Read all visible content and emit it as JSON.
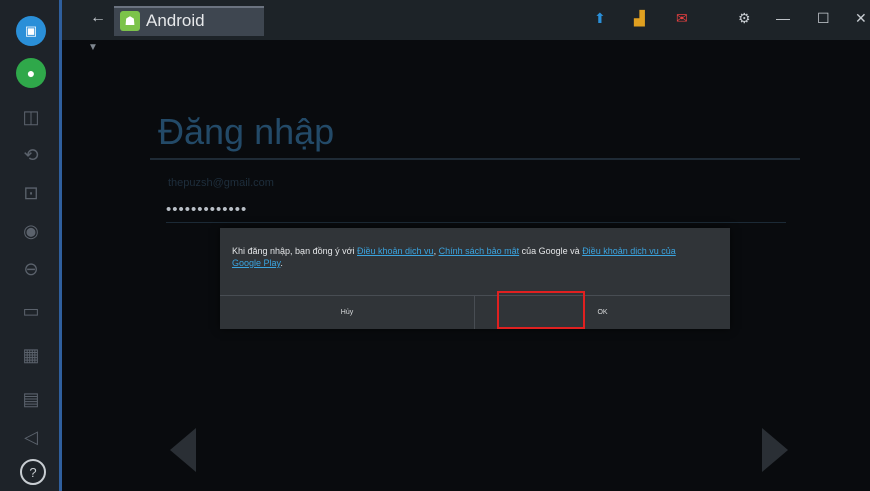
{
  "window": {
    "tab_title": "Android"
  },
  "sidebar": {
    "items": [
      {
        "icon": "camera-icon"
      },
      {
        "icon": "chat-icon"
      },
      {
        "icon": "multi-window-icon"
      },
      {
        "icon": "rotate-icon"
      },
      {
        "icon": "screenshot-icon"
      },
      {
        "icon": "location-icon"
      },
      {
        "icon": "shake-icon"
      },
      {
        "icon": "folder-icon"
      },
      {
        "icon": "copy-icon"
      },
      {
        "icon": "paste-icon"
      },
      {
        "icon": "volume-icon"
      },
      {
        "icon": "help-icon",
        "label": "?"
      }
    ]
  },
  "login": {
    "heading": "Đăng nhập",
    "email": "thepuzsh@gmail.com",
    "password_mask": "•••••••••••••"
  },
  "dialog": {
    "msg_1": "Khi đăng nhập, bạn đồng ý với ",
    "link_1": "Điều khoản dịch vụ",
    "sep_1": ", ",
    "link_2": "Chính sách bảo mật",
    "msg_2": " của Google và ",
    "link_3": "Điều khoản dịch vụ của Google Play",
    "msg_3": ".",
    "cancel_label": "Hủy",
    "ok_label": "OK"
  },
  "colors": {
    "accent_blue": "#2a8fd8",
    "highlight": "#e02020",
    "link": "#3aa4e0"
  }
}
